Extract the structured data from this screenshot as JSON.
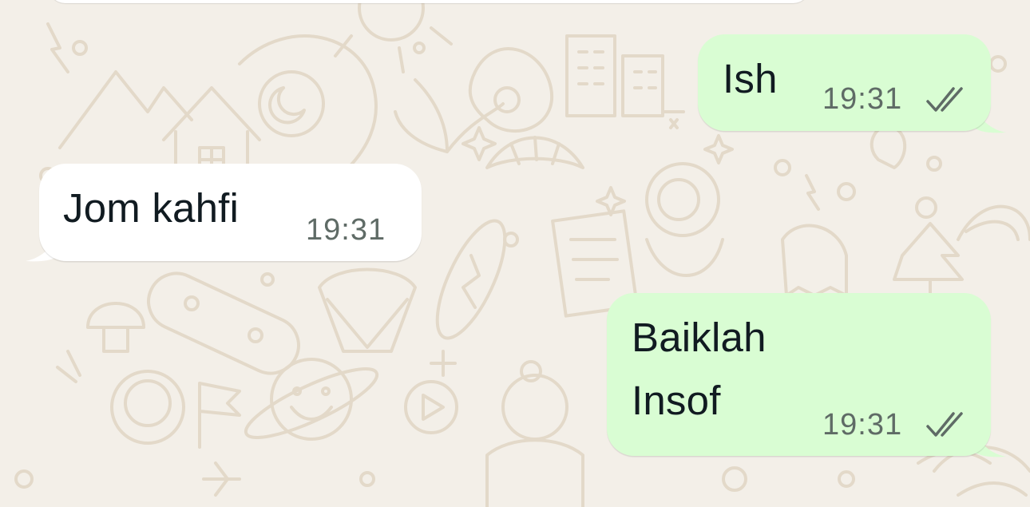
{
  "chat": {
    "messages": [
      {
        "direction": "outgoing",
        "lines": [
          "Ish"
        ],
        "time": "19:31",
        "status_icon": "double-check-icon"
      },
      {
        "direction": "incoming",
        "lines": [
          "Jom kahfi"
        ],
        "time": "19:31"
      },
      {
        "direction": "outgoing",
        "lines": [
          "Baiklah",
          "Insof"
        ],
        "time": "19:31",
        "status_icon": "double-check-icon"
      }
    ]
  },
  "colors": {
    "wallpaper": "#f3efe8",
    "doodle": "#e3d9c9",
    "outgoing_bubble": "#d9fdd3",
    "incoming_bubble": "#ffffff",
    "text": "#111b21",
    "meta": "#5f6b66"
  }
}
